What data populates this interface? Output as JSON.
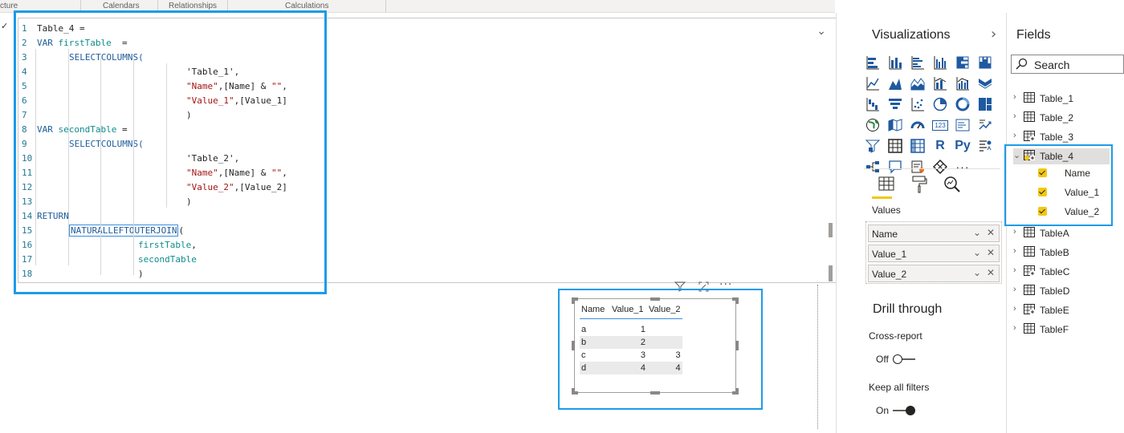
{
  "ribbon": {
    "tabs": [
      "cture",
      "Calendars",
      "Relationships",
      "Calculations"
    ]
  },
  "editor": {
    "check_glyph": "✓",
    "lines": [
      {
        "n": "1",
        "parts": [
          {
            "c": "plain",
            "t": "Table_4 ="
          }
        ]
      },
      {
        "n": "2",
        "parts": [
          {
            "c": "kw",
            "t": "VAR "
          },
          {
            "c": "var",
            "t": "firstTable"
          },
          {
            "c": "plain",
            "t": "  ="
          }
        ]
      },
      {
        "n": "3",
        "parts": [
          {
            "c": "fn",
            "t": "SELECTCOLUMNS("
          }
        ]
      },
      {
        "n": "4",
        "parts": [
          {
            "c": "plain",
            "t": "'Table_1',"
          }
        ]
      },
      {
        "n": "5",
        "parts": [
          {
            "c": "str",
            "t": "\"Name\""
          },
          {
            "c": "plain",
            "t": ",[Name] & "
          },
          {
            "c": "str",
            "t": "\"\""
          },
          {
            "c": "plain",
            "t": ","
          }
        ]
      },
      {
        "n": "6",
        "parts": [
          {
            "c": "str",
            "t": "\"Value_1\""
          },
          {
            "c": "plain",
            "t": ",[Value_1]"
          }
        ]
      },
      {
        "n": "7",
        "parts": [
          {
            "c": "plain",
            "t": ")"
          }
        ]
      },
      {
        "n": "8",
        "parts": [
          {
            "c": "kw",
            "t": "VAR "
          },
          {
            "c": "var",
            "t": "secondTable"
          },
          {
            "c": "plain",
            "t": " ="
          }
        ]
      },
      {
        "n": "9",
        "parts": [
          {
            "c": "fn",
            "t": "SELECTCOLUMNS("
          }
        ]
      },
      {
        "n": "10",
        "parts": [
          {
            "c": "plain",
            "t": "'Table_2',"
          }
        ]
      },
      {
        "n": "11",
        "parts": [
          {
            "c": "str",
            "t": "\"Name\""
          },
          {
            "c": "plain",
            "t": ",[Name] & "
          },
          {
            "c": "str",
            "t": "\"\""
          },
          {
            "c": "plain",
            "t": ","
          }
        ]
      },
      {
        "n": "12",
        "parts": [
          {
            "c": "str",
            "t": "\"Value_2\""
          },
          {
            "c": "plain",
            "t": ",[Value_2]"
          }
        ]
      },
      {
        "n": "13",
        "parts": [
          {
            "c": "plain",
            "t": ")"
          }
        ]
      },
      {
        "n": "14",
        "parts": [
          {
            "c": "kw",
            "t": "RETURN"
          }
        ]
      },
      {
        "n": "15",
        "parts": [
          {
            "c": "fn",
            "t": "NATURALLEFTOUTERJOIN",
            "box": true
          },
          {
            "c": "plain",
            "t": "("
          }
        ]
      },
      {
        "n": "16",
        "parts": [
          {
            "c": "var",
            "t": "firstTable"
          },
          {
            "c": "plain",
            "t": ","
          }
        ]
      },
      {
        "n": "17",
        "parts": [
          {
            "c": "var",
            "t": "secondTable"
          }
        ]
      },
      {
        "n": "18",
        "parts": [
          {
            "c": "plain",
            "t": ")"
          }
        ]
      }
    ],
    "chevron": "⌄"
  },
  "visual": {
    "headers": [
      "Name",
      "Value_1",
      "Value_2"
    ],
    "rows": [
      [
        "a",
        "1",
        ""
      ],
      [
        "b",
        "2",
        ""
      ],
      [
        "c",
        "3",
        "3"
      ],
      [
        "d",
        "4",
        "4"
      ]
    ],
    "icons": [
      "filter-icon",
      "focus-mode-icon",
      "more-options-icon"
    ]
  },
  "visualizations": {
    "title": "Visualizations",
    "chevron": "›",
    "icons": [
      "stacked-bar-icon",
      "stacked-column-icon",
      "clustered-bar-icon",
      "clustered-column-icon",
      "100-stacked-bar-icon",
      "100-stacked-column-icon",
      "line-chart-icon",
      "area-chart-icon",
      "stacked-area-icon",
      "line-column-icon",
      "line-clustered-column-icon",
      "ribbon-chart-icon",
      "waterfall-icon",
      "funnel-icon",
      "scatter-icon",
      "pie-icon",
      "donut-icon",
      "treemap-icon",
      "map-icon",
      "filled-map-icon",
      "gauge-icon",
      "card-icon",
      "multi-row-card-icon",
      "kpi-icon",
      "slicer-icon",
      "table-icon",
      "matrix-icon",
      "r-visual-icon",
      "python-visual-icon",
      "key-influencers-icon",
      "decomposition-tree-icon",
      "qa-icon",
      "smart-narrative-icon",
      "power-apps-icon",
      "more-visuals-icon"
    ],
    "card_text": "123",
    "r_text": "R",
    "py_text": "Py",
    "more_text": "···",
    "values_label": "Values",
    "wells": [
      "Name",
      "Value_1",
      "Value_2"
    ],
    "drill_through": "Drill through",
    "cross_report": "Cross-report",
    "cross_report_state": "Off",
    "keep_filters": "Keep all filters",
    "keep_filters_state": "On",
    "toggle_color": "#252423"
  },
  "fields": {
    "title": "Fields",
    "search_placeholder": "Search",
    "tables": [
      {
        "name": "Table_1",
        "expanded": false
      },
      {
        "name": "Table_2",
        "expanded": false
      },
      {
        "name": "Table_3",
        "expanded": false
      },
      {
        "name": "Table_4",
        "expanded": true,
        "columns": [
          "Name",
          "Value_1",
          "Value_2"
        ]
      },
      {
        "name": "TableA",
        "expanded": false
      },
      {
        "name": "TableB",
        "expanded": false
      },
      {
        "name": "TableC",
        "expanded": false
      },
      {
        "name": "TableD",
        "expanded": false
      },
      {
        "name": "TableE",
        "expanded": false
      },
      {
        "name": "TableF",
        "expanded": false
      }
    ]
  },
  "colors": {
    "highlight": "#1d9be8",
    "accent_yellow": "#f2c811",
    "dax_keyword": "#1e5c9a",
    "dax_variable": "#118c8c",
    "dax_string": "#a31515"
  }
}
